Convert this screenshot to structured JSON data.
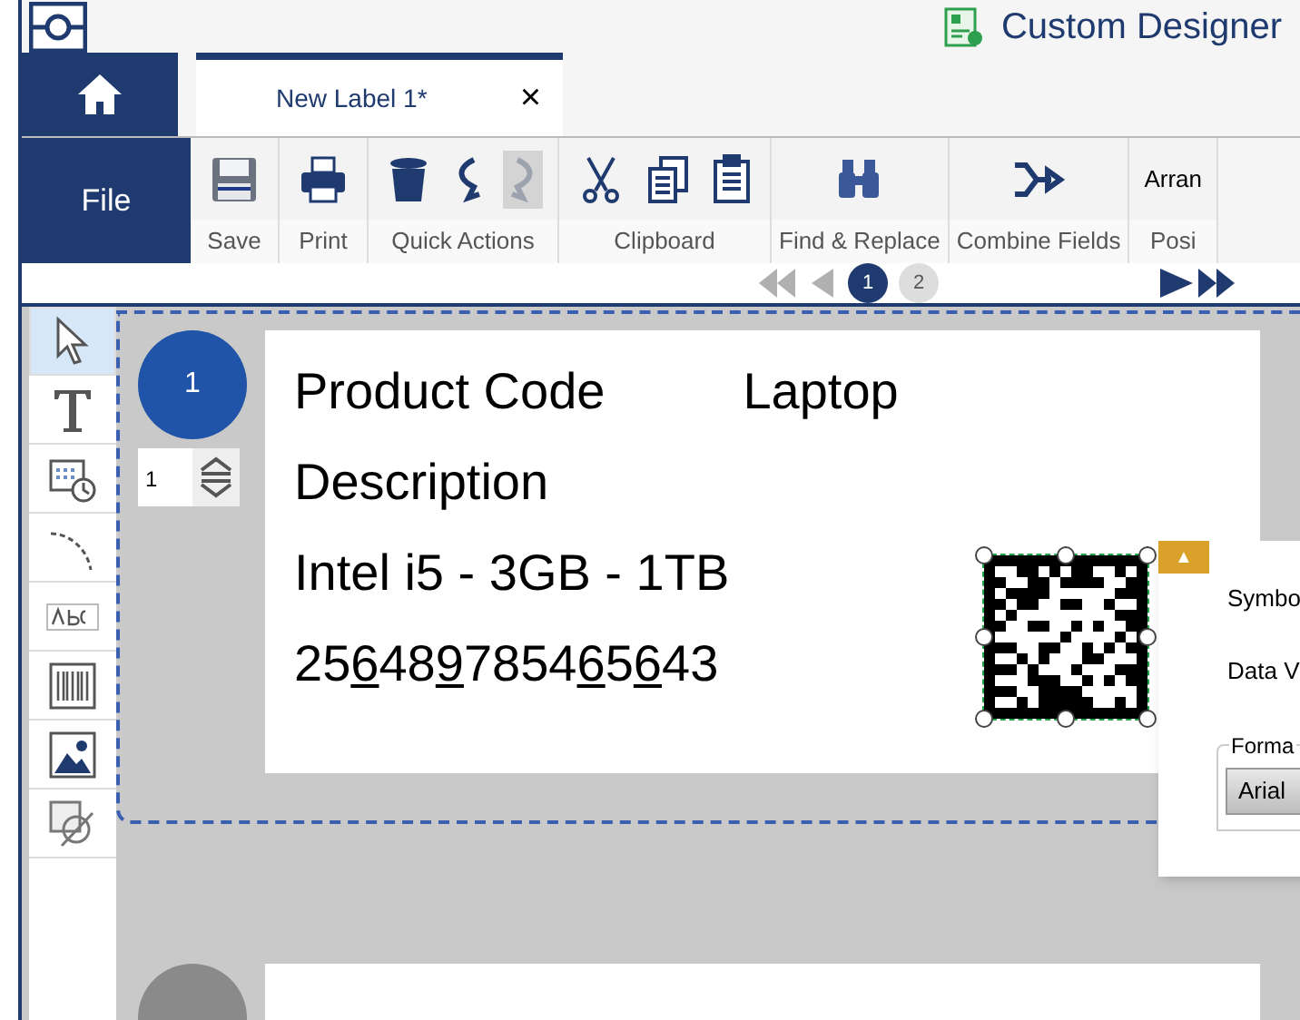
{
  "window": {
    "title": "Custom Designer"
  },
  "tabs": [
    {
      "label": "New Label 1*",
      "selected": true,
      "close": "×"
    }
  ],
  "file_button": "File",
  "ribbon": [
    {
      "label": "Save",
      "tools": [
        {
          "kind": "save",
          "disabled": false
        }
      ]
    },
    {
      "label": "Print",
      "tools": [
        {
          "kind": "print",
          "disabled": false
        }
      ]
    },
    {
      "label": "Quick Actions",
      "tools": [
        {
          "kind": "delete",
          "disabled": false
        },
        {
          "kind": "undo",
          "disabled": false
        },
        {
          "kind": "redo",
          "disabled": true
        }
      ]
    },
    {
      "label": "Clipboard",
      "tools": [
        {
          "kind": "cut",
          "disabled": false
        },
        {
          "kind": "copy",
          "disabled": false
        },
        {
          "kind": "paste",
          "disabled": false
        }
      ]
    },
    {
      "label": "Find & Replace",
      "tools": [
        {
          "kind": "find",
          "disabled": false
        }
      ]
    },
    {
      "label": "Combine Fields",
      "tools": [
        {
          "kind": "combine",
          "disabled": false
        }
      ]
    },
    {
      "label": "Posi",
      "top_text": "Arran"
    }
  ],
  "pager": {
    "first_disabled": true,
    "prev_disabled": true,
    "next_disabled": false,
    "last_disabled": false,
    "pages": [
      {
        "label": "1",
        "selected": true
      },
      {
        "label": "2",
        "selected": false
      }
    ]
  },
  "toolbox": [
    {
      "kind": "pointer",
      "selected": true
    },
    {
      "kind": "text",
      "selected": false
    },
    {
      "kind": "datetime",
      "selected": false
    },
    {
      "kind": "curved",
      "selected": false
    },
    {
      "kind": "abc",
      "selected": false
    },
    {
      "kind": "barcode",
      "selected": false
    },
    {
      "kind": "image",
      "selected": false
    },
    {
      "kind": "shape",
      "selected": false
    }
  ],
  "labels": [
    {
      "number": "1",
      "selected": true,
      "quantity": "1",
      "lines": [
        [
          {
            "text": "Product Code",
            "underlined": false
          },
          {
            "text": "Laptop",
            "underlined": false
          }
        ],
        [
          {
            "text": "Description",
            "underlined": false
          }
        ],
        [
          {
            "text": "Intel i5 - 3GB - 1TB",
            "underlined": false
          }
        ],
        [
          {
            "text": "25",
            "underlined": false
          },
          {
            "text": "6",
            "underlined": true
          },
          {
            "text": "48",
            "underlined": false
          },
          {
            "text": "9",
            "underlined": true
          },
          {
            "text": "7854",
            "underlined": false
          },
          {
            "text": "6",
            "underlined": true
          },
          {
            "text": "5",
            "underlined": false
          },
          {
            "text": "6",
            "underlined": true
          },
          {
            "text": "43",
            "underlined": false
          }
        ]
      ]
    },
    {
      "selected": false
    }
  ],
  "properties_popup": {
    "warning": "▲",
    "fields": [
      "Symbo",
      "Data V"
    ],
    "group": "Forma",
    "font": "Arial"
  }
}
